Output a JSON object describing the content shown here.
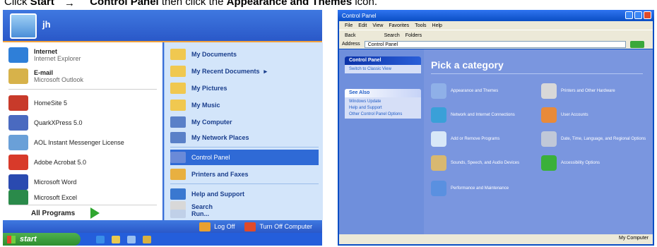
{
  "instruction": {
    "prefix": "Click",
    "start": "Start",
    "arrow": "→",
    "control_panel": "Control Panel",
    "middle": "then click the",
    "appearance": "Appearance and Themes",
    "suffix": "icon."
  },
  "start_menu": {
    "user_name": "jh",
    "pinned": [
      {
        "title": "Internet",
        "subtitle": "Internet Explorer",
        "icon": "internet-explorer-icon",
        "color": "#2f7fd8"
      },
      {
        "title": "E-mail",
        "subtitle": "Microsoft Outlook",
        "icon": "outlook-icon",
        "color": "#d7b24a"
      }
    ],
    "recent": [
      {
        "label": "HomeSite 5",
        "icon": "homesite-icon",
        "color": "#c83a2a"
      },
      {
        "label": "QuarkXPress 5.0",
        "icon": "quarkxpress-icon",
        "color": "#4a6ac0"
      },
      {
        "label": "AOL Instant Messenger License",
        "icon": "aim-icon",
        "color": "#6aa0d8"
      },
      {
        "label": "Adobe Acrobat 5.0",
        "icon": "acrobat-icon",
        "color": "#d83a2a"
      },
      {
        "label": "Microsoft Word",
        "icon": "word-icon",
        "color": "#2a4ab0"
      },
      {
        "label": "Microsoft Excel",
        "icon": "excel-icon",
        "color": "#2a8a4a"
      }
    ],
    "all_programs": "All Programs",
    "right_items": [
      {
        "label": "My Documents",
        "icon": "folder-icon",
        "color": "#f0c850"
      },
      {
        "label": "My Recent Documents",
        "icon": "recent-documents-icon",
        "color": "#f0c850",
        "has_arrow": true
      },
      {
        "label": "My Pictures",
        "icon": "pictures-folder-icon",
        "color": "#f0c850"
      },
      {
        "label": "My Music",
        "icon": "music-folder-icon",
        "color": "#f0c850"
      },
      {
        "label": "My Computer",
        "icon": "computer-icon",
        "color": "#5a80c8"
      },
      {
        "label": "My Network Places",
        "icon": "network-places-icon",
        "color": "#5a80c8"
      },
      {
        "label": "Control Panel",
        "icon": "control-panel-icon",
        "color": "#6a8ad8",
        "highlighted": true
      },
      {
        "label": "Printers and Faxes",
        "icon": "printer-icon",
        "color": "#e8b040"
      },
      {
        "label": "Help and Support",
        "icon": "help-icon",
        "color": "#3a78d0"
      },
      {
        "label": "Search",
        "icon": "search-icon",
        "color": "#d8d8d8"
      },
      {
        "label": "Run...",
        "icon": "run-icon",
        "color": "#c0d0e8"
      }
    ],
    "recent_arrow": "▸",
    "footer": {
      "log_off": "Log Off",
      "turn_off": "Turn Off Computer",
      "log_off_color": "#e8a030",
      "turn_off_color": "#e04a2a"
    },
    "taskbar": {
      "start_label": "start"
    }
  },
  "control_panel": {
    "title": "Control Panel",
    "menu": [
      "File",
      "Edit",
      "View",
      "Favorites",
      "Tools",
      "Help"
    ],
    "toolbar": [
      "Back",
      "Search",
      "Folders"
    ],
    "address_label": "Address",
    "address_value": "Control Panel",
    "sidebar": {
      "panel1_title": "Control Panel",
      "panel1_link": "Switch to Classic View",
      "panel2_title": "See Also",
      "panel2_links": [
        "Windows Update",
        "Help and Support",
        "Other Control Panel Options"
      ]
    },
    "heading": "Pick a category",
    "categories": [
      {
        "label": "Appearance and Themes",
        "icon": "appearance-themes-icon",
        "color": "#8fb0e8"
      },
      {
        "label": "Printers and Other Hardware",
        "icon": "printers-hardware-icon",
        "color": "#d8d8d8"
      },
      {
        "label": "Network and Internet Connections",
        "icon": "network-connections-icon",
        "color": "#3aa0d8"
      },
      {
        "label": "User Accounts",
        "icon": "user-accounts-icon",
        "color": "#e88a3a"
      },
      {
        "label": "Add or Remove Programs",
        "icon": "add-remove-programs-icon",
        "color": "#d8e8f8"
      },
      {
        "label": "Date, Time, Language, and Regional Options",
        "icon": "date-time-icon",
        "color": "#c0c8d8"
      },
      {
        "label": "Sounds, Speech, and Audio Devices",
        "icon": "sounds-icon",
        "color": "#d8b870"
      },
      {
        "label": "Accessibility Options",
        "icon": "accessibility-icon",
        "color": "#3ab03a"
      },
      {
        "label": "Performance and Maintenance",
        "icon": "performance-icon",
        "color": "#5a90e0"
      }
    ],
    "status": "My Computer"
  }
}
